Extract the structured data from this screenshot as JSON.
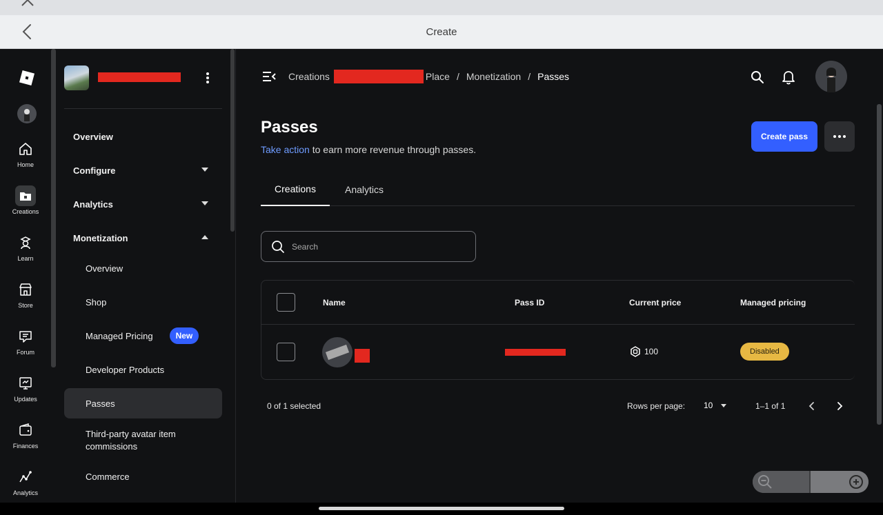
{
  "browser": {
    "title": "Create"
  },
  "rail": {
    "items": [
      {
        "label": "Home",
        "icon": "home-icon"
      },
      {
        "label": "Creations",
        "icon": "creations-icon"
      },
      {
        "label": "Learn",
        "icon": "learn-icon"
      },
      {
        "label": "Store",
        "icon": "store-icon"
      },
      {
        "label": "Forum",
        "icon": "forum-icon"
      },
      {
        "label": "Updates",
        "icon": "updates-icon"
      },
      {
        "label": "Finances",
        "icon": "finances-icon"
      },
      {
        "label": "Analytics",
        "icon": "analytics-icon"
      }
    ]
  },
  "sidenav": {
    "items": [
      {
        "label": "Overview"
      },
      {
        "label": "Configure"
      },
      {
        "label": "Analytics"
      },
      {
        "label": "Monetization"
      },
      {
        "label": "Overview"
      },
      {
        "label": "Shop"
      },
      {
        "label": "Managed Pricing",
        "badge": "New"
      },
      {
        "label": "Developer Products"
      },
      {
        "label": "Passes"
      },
      {
        "label": "Third-party avatar item commissions"
      },
      {
        "label": "Commerce"
      }
    ]
  },
  "header": {
    "breadcrumbs": [
      "Creations",
      "Place",
      "Monetization",
      "Passes"
    ],
    "separator": "/"
  },
  "page": {
    "title": "Passes",
    "subtitle_link": "Take action",
    "subtitle_rest": " to earn more revenue through passes.",
    "create_button": "Create pass"
  },
  "tabs": [
    {
      "label": "Creations",
      "active": true
    },
    {
      "label": "Analytics",
      "active": false
    }
  ],
  "search": {
    "placeholder": "Search"
  },
  "table": {
    "columns": [
      "Name",
      "Pass ID",
      "Current price",
      "Managed pricing"
    ],
    "rows": [
      {
        "price": "100",
        "managed_pricing": "Disabled"
      }
    ]
  },
  "footer": {
    "selected": "0 of 1 selected",
    "rows_per_page_label": "Rows per page:",
    "rows_per_page": "10",
    "range": "1–1 of 1"
  },
  "colors": {
    "accent": "#335fff",
    "link": "#6f9cff",
    "status_disabled": "#e7b843",
    "redaction": "#e3281f"
  }
}
